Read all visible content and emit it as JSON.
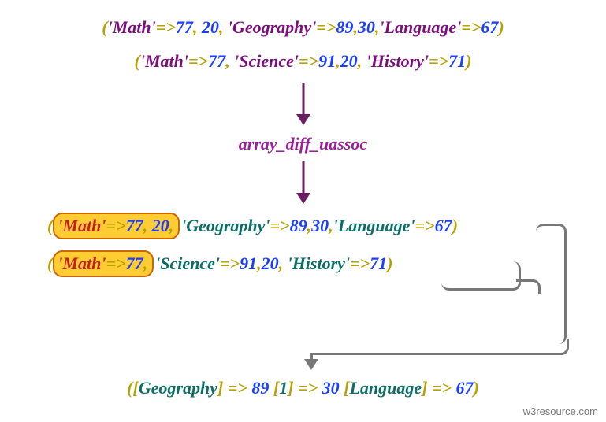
{
  "input1": {
    "pairs": [
      {
        "key": "Math",
        "value": 77,
        "extra": 20
      },
      {
        "key": "Geography",
        "value": 89,
        "extra": 30
      },
      {
        "key": "Language",
        "value": 67
      }
    ]
  },
  "input2": {
    "pairs": [
      {
        "key": "Math",
        "value": 77
      },
      {
        "key": "Science",
        "value": 91,
        "extra": 20
      },
      {
        "key": "History",
        "value": 71
      }
    ]
  },
  "function_name": "array_diff_uassoc",
  "step3": {
    "row1": {
      "highlighted": [
        {
          "key": "Math",
          "value": 77,
          "extra": 20
        }
      ],
      "rest": [
        {
          "key": "Geography",
          "value": 89,
          "extra": 30
        },
        {
          "key": "Language",
          "value": 67
        }
      ]
    },
    "row2": {
      "highlighted": [
        {
          "key": "Math",
          "value": 77
        }
      ],
      "rest": [
        {
          "key": "Science",
          "value": 91,
          "extra": 20
        },
        {
          "key": "History",
          "value": 71
        }
      ]
    }
  },
  "output": [
    {
      "key": "Geography",
      "value": 89
    },
    {
      "key": "1",
      "value": 30
    },
    {
      "key": "Language",
      "value": 67
    }
  ],
  "attribution": "w3resource.com"
}
